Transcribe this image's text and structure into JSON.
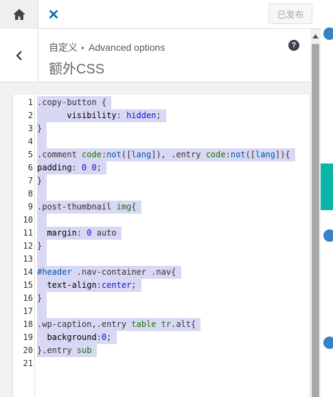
{
  "topbar": {
    "publish_label": "已发布",
    "close_symbol": "✕"
  },
  "header": {
    "breadcrumb_root": "自定义",
    "breadcrumb_arrow": "▸",
    "breadcrumb_current": "Advanced options",
    "title": "额外CSS",
    "help_symbol": "?"
  },
  "code": {
    "lines": [
      {
        "n": "1",
        "text": ".copy-button {"
      },
      {
        "n": "2",
        "text": "      visibility: hidden;"
      },
      {
        "n": "3",
        "text": "}"
      },
      {
        "n": "4",
        "text": ""
      },
      {
        "n": "5",
        "text": ".comment code:not([lang]), .entry code:not([lang]){"
      },
      {
        "n": "6",
        "text": "padding: 0 0;"
      },
      {
        "n": "7",
        "text": "}"
      },
      {
        "n": "8",
        "text": ""
      },
      {
        "n": "9",
        "text": ".post-thumbnail img{"
      },
      {
        "n": "10",
        "text": ""
      },
      {
        "n": "11",
        "text": "  margin: 0 auto"
      },
      {
        "n": "12",
        "text": "}"
      },
      {
        "n": "13",
        "text": ""
      },
      {
        "n": "14",
        "text": "#header .nav-container .nav{"
      },
      {
        "n": "15",
        "text": "  text-align:center;"
      },
      {
        "n": "16",
        "text": "}"
      },
      {
        "n": "17",
        "text": ""
      },
      {
        "n": "18",
        "text": ".wp-caption,.entry table tr.alt{"
      },
      {
        "n": "19",
        "text": "  background:0;"
      },
      {
        "n": "20",
        "text": "}.entry sub"
      },
      {
        "n": "21",
        "text": ""
      }
    ]
  },
  "colors": {
    "accent": "#0073aa",
    "highlight": "#d8d8f4",
    "teal": "#0ab6a6"
  }
}
